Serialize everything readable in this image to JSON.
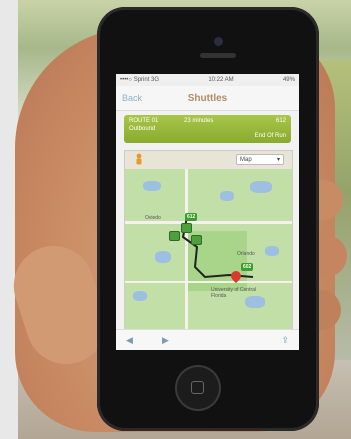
{
  "status_bar": {
    "carrier": "••••○ Sprint 3G",
    "time": "10:22 AM",
    "battery": "49%"
  },
  "nav": {
    "back_label": "Back",
    "title": "Shuttles"
  },
  "route_card": {
    "route": "ROUTE 01",
    "direction": "Outbound",
    "time": "23 minutes",
    "number": "612",
    "end_label": "End Of Run"
  },
  "map": {
    "type_selector": "Map",
    "labels": {
      "oviedo": "Oviedo",
      "orlando": "Orlando",
      "ucf": "University of Central Florida",
      "stop_a": "612",
      "stop_b": "602"
    }
  },
  "colors": {
    "route_card": "#88ab2e",
    "nav_title": "#b08e6a",
    "link": "#8cb3c8",
    "destination_pin": "#d93a2e",
    "stop_badge": "#3a9d2e"
  },
  "icons": {
    "person": "person-icon",
    "back_arrow": "back-arrow-icon",
    "forward_arrow": "forward-arrow-icon",
    "share": "share-icon"
  }
}
